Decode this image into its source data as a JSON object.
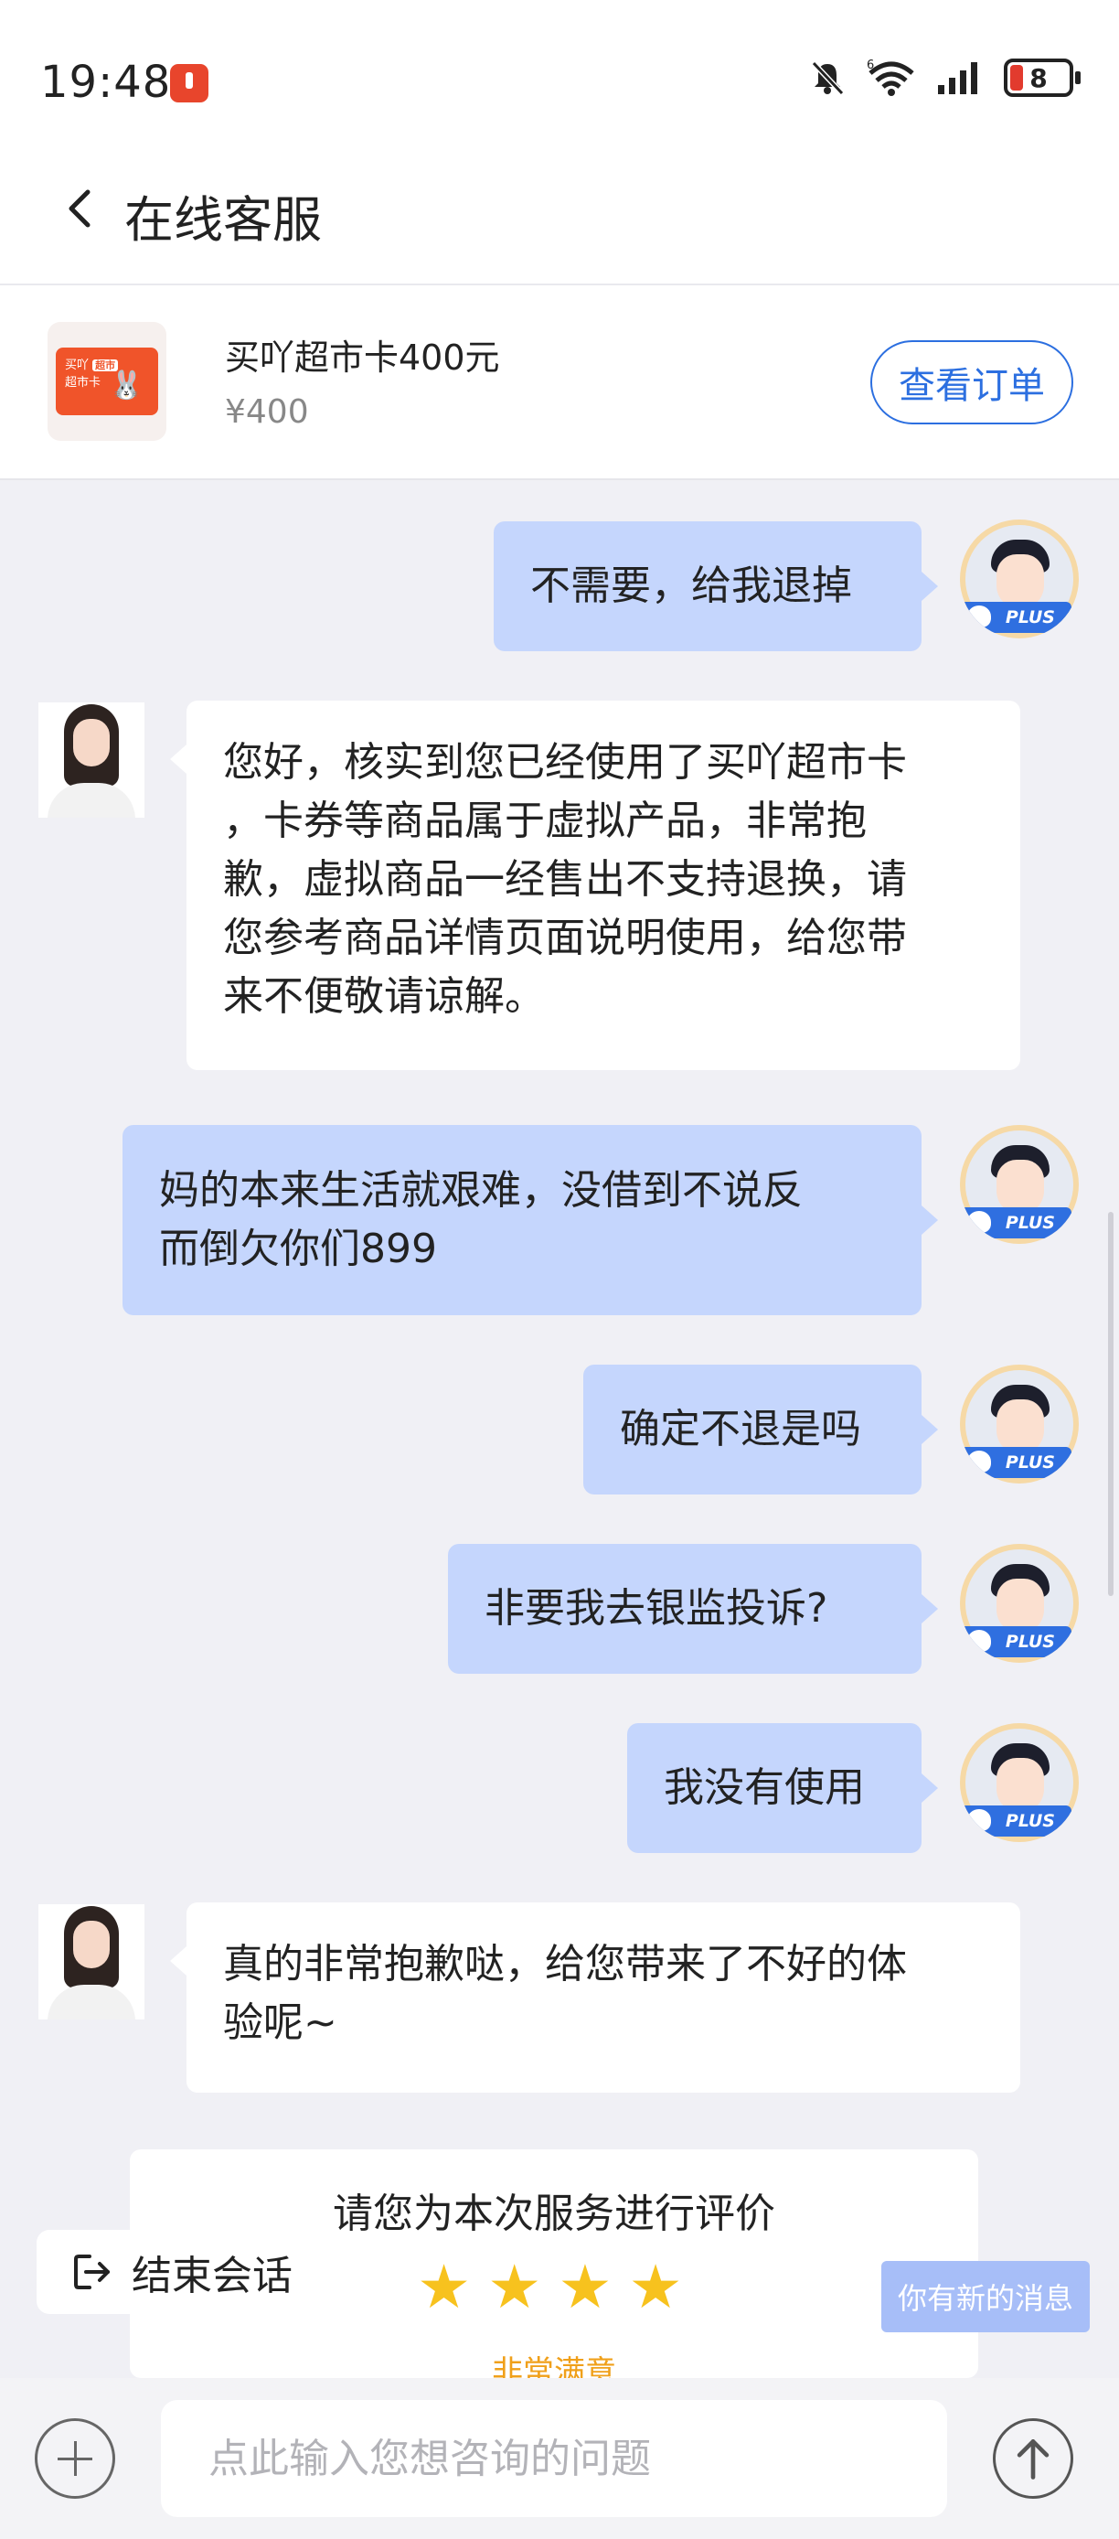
{
  "status_bar": {
    "time": "19:48",
    "battery_level": "8",
    "icons": [
      "notification-badge-icon",
      "bell-muted-icon",
      "wifi-6-icon",
      "signal-icon",
      "battery-icon"
    ]
  },
  "header": {
    "title": "在线客服"
  },
  "order": {
    "product_name": "买吖超市卡400元",
    "price": "¥400",
    "view_order_label": "查看订单",
    "card_logo_text": "买吖",
    "card_logo_tag": "超市",
    "card_logo_sub": "超市卡"
  },
  "messages": [
    {
      "from": "user",
      "text": "不需要，给我退掉"
    },
    {
      "from": "agent",
      "lines": [
        "您好，核实到您已经使用了买吖超市卡",
        "，卡券等商品属于虚拟产品，非常抱",
        "歉，虚拟商品一经售出不支持退换，请",
        "您参考商品详情页面说明使用，给您带",
        "来不便敬请谅解。"
      ]
    },
    {
      "from": "user",
      "lines": [
        "妈的本来生活就艰难，没借到不说反",
        "而倒欠你们899"
      ]
    },
    {
      "from": "user",
      "text": "确定不退是吗"
    },
    {
      "from": "user",
      "text": "非要我去银监投诉?"
    },
    {
      "from": "user",
      "text": "我没有使用"
    },
    {
      "from": "agent",
      "lines": [
        "真的非常抱歉哒，给您带来了不好的体",
        "验呢~"
      ]
    }
  ],
  "badge": {
    "plus": "PLUS"
  },
  "rating": {
    "title": "请您为本次服务进行评价",
    "stars_shown": 4,
    "label": "非常满意"
  },
  "end_session_label": "结束会话",
  "new_message_label": "你有新的消息",
  "input": {
    "placeholder": "点此输入您想咨询的问题"
  },
  "colors": {
    "user_bubble": "#c5d6fd",
    "accent_blue": "#2c6fe0",
    "star": "#f7c21e",
    "rating_label": "#f0a01a"
  }
}
